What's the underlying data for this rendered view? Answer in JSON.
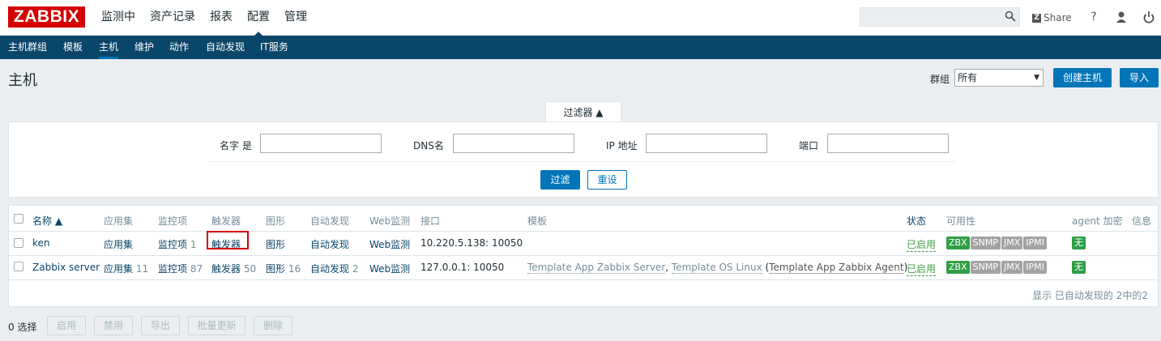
{
  "logo": "ZABBIX",
  "main_menu": [
    {
      "label": "监测中"
    },
    {
      "label": "资产记录"
    },
    {
      "label": "报表"
    },
    {
      "label": "配置"
    },
    {
      "label": "管理"
    }
  ],
  "header_right": {
    "search_placeholder": "",
    "share_label": "Share",
    "share_badge": "Z",
    "help": "?"
  },
  "sub_menu": [
    {
      "label": "主机群组"
    },
    {
      "label": "模板"
    },
    {
      "label": "主机"
    },
    {
      "label": "维护"
    },
    {
      "label": "动作"
    },
    {
      "label": "自动发现"
    },
    {
      "label": "IT服务"
    }
  ],
  "page": {
    "title": "主机",
    "group_label": "群组",
    "group_value": "所有",
    "create_button": "创建主机",
    "import_button": "导入"
  },
  "filter": {
    "tab_label": "过滤器 ▲",
    "name_label": "名字 是",
    "dns_label": "DNS名",
    "ip_label": "IP 地址",
    "port_label": "端口",
    "name_value": "",
    "dns_value": "",
    "ip_value": "",
    "port_value": "",
    "apply_button": "过滤",
    "reset_button": "重设"
  },
  "table": {
    "headers": {
      "name": "名称 ▲",
      "apps": "应用集",
      "items": "监控项",
      "triggers": "触发器",
      "graphs": "图形",
      "discovery": "自动发现",
      "web": "Web监测",
      "interface": "接口",
      "templates": "模板",
      "status": "状态",
      "availability": "可用性",
      "agent_encryption": "agent 加密",
      "info": "信息"
    },
    "rows": [
      {
        "name": "ken",
        "apps": "应用集",
        "apps_count": "",
        "items": "监控项",
        "items_count": "1",
        "triggers": "触发器",
        "triggers_count": "",
        "graphs": "图形",
        "graphs_count": "",
        "discovery": "自动发现",
        "discovery_count": "",
        "web": "Web监测",
        "interface": "10.220.5.138: 10050",
        "tpl1": "",
        "tpl_sep1": "",
        "tpl2": "",
        "tpl_open": "",
        "tpl3": "",
        "tpl_close": "",
        "status": "已启用",
        "zbx": "ZBX",
        "snmp": "SNMP",
        "jmx": "JMX",
        "ipmi": "IPMI",
        "encryption": "无"
      },
      {
        "name": "Zabbix server",
        "apps": "应用集",
        "apps_count": "11",
        "items": "监控项",
        "items_count": "87",
        "triggers": "触发器",
        "triggers_count": "50",
        "graphs": "图形",
        "graphs_count": "16",
        "discovery": "自动发现",
        "discovery_count": "2",
        "web": "Web监测",
        "interface": "127.0.0.1: 10050",
        "tpl1": "Template App Zabbix Server",
        "tpl_sep1": ", ",
        "tpl2": "Template OS Linux",
        "tpl_open": " (",
        "tpl3": "Template App Zabbix Agent",
        "tpl_close": ")",
        "status": "已启用",
        "zbx": "ZBX",
        "snmp": "SNMP",
        "jmx": "JMX",
        "ipmi": "IPMI",
        "encryption": "无"
      }
    ],
    "footer": "显示 已自动发现的 2中的2"
  },
  "actions": {
    "selected": "0 选择",
    "enable": "启用",
    "disable": "禁用",
    "export": "导出",
    "mass_update": "批量更新",
    "delete": "删除"
  },
  "colors": {
    "brand": "#d40000",
    "submenu_bg": "#0a466a",
    "primary": "#0275b8",
    "available": "#2f9f45",
    "unknown": "#a3a3a3",
    "enabled": "#429e47"
  }
}
